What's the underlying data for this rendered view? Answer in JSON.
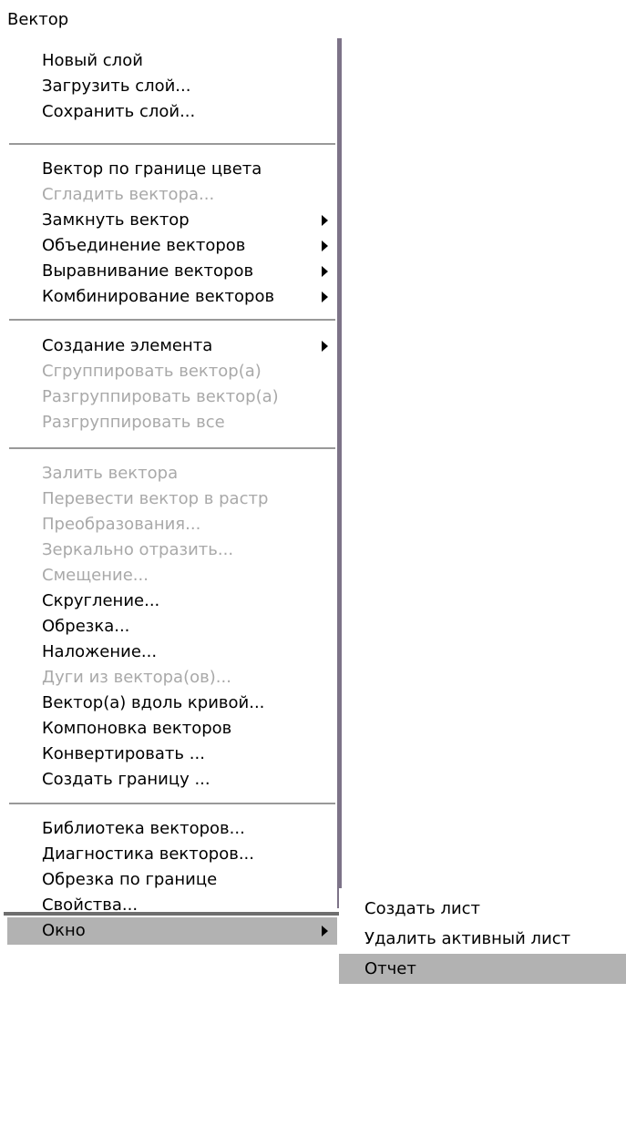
{
  "menu_title": "Вектор",
  "items": [
    {
      "label": "Новый слой",
      "disabled": false
    },
    {
      "label": "Загрузить слой...",
      "disabled": false
    },
    {
      "label": "Сохранить слой...",
      "disabled": false
    },
    {
      "label": "Вектор по границе цвета",
      "disabled": false
    },
    {
      "label": "Сгладить вектора...",
      "disabled": true
    },
    {
      "label": "Замкнуть вектор",
      "disabled": false,
      "submenu": true
    },
    {
      "label": "Объединение векторов",
      "disabled": false,
      "submenu": true
    },
    {
      "label": "Выравнивание векторов",
      "disabled": false,
      "submenu": true
    },
    {
      "label": "Комбинирование векторов",
      "disabled": false,
      "submenu": true
    },
    {
      "label": "Создание элемента",
      "disabled": false,
      "submenu": true
    },
    {
      "label": "Сгруппировать вектор(а)",
      "disabled": true
    },
    {
      "label": "Разгруппировать вектор(а)",
      "disabled": true
    },
    {
      "label": "Разгруппировать все",
      "disabled": true
    },
    {
      "label": "Залить вектора",
      "disabled": true
    },
    {
      "label": "Перевести вектор в растр",
      "disabled": true
    },
    {
      "label": "Преобразования...",
      "disabled": true
    },
    {
      "label": "Зеркально отразить...",
      "disabled": true
    },
    {
      "label": "Смещение...",
      "disabled": true
    },
    {
      "label": "Скругление...",
      "disabled": false
    },
    {
      "label": "Обрезка...",
      "disabled": false
    },
    {
      "label": "Наложение...",
      "disabled": false
    },
    {
      "label": "Дуги из вектора(ов)...",
      "disabled": true
    },
    {
      "label": "Вектор(а) вдоль кривой...",
      "disabled": false
    },
    {
      "label": "Компоновка векторов",
      "disabled": false
    },
    {
      "label": "Конвертировать ...",
      "disabled": false
    },
    {
      "label": "Создать границу ...",
      "disabled": false
    },
    {
      "label": "Библиотека векторов...",
      "disabled": false
    },
    {
      "label": "Диагностика векторов...",
      "disabled": false
    },
    {
      "label": "Обрезка по границе",
      "disabled": false
    },
    {
      "label": "Свойства...",
      "disabled": false
    },
    {
      "label": "Окно",
      "disabled": false,
      "submenu": true,
      "highlighted": true
    }
  ],
  "submenu_items": [
    {
      "label": "Создать лист",
      "highlighted": false
    },
    {
      "label": "Удалить активный лист",
      "highlighted": false
    },
    {
      "label": "Отчет",
      "highlighted": true
    }
  ]
}
